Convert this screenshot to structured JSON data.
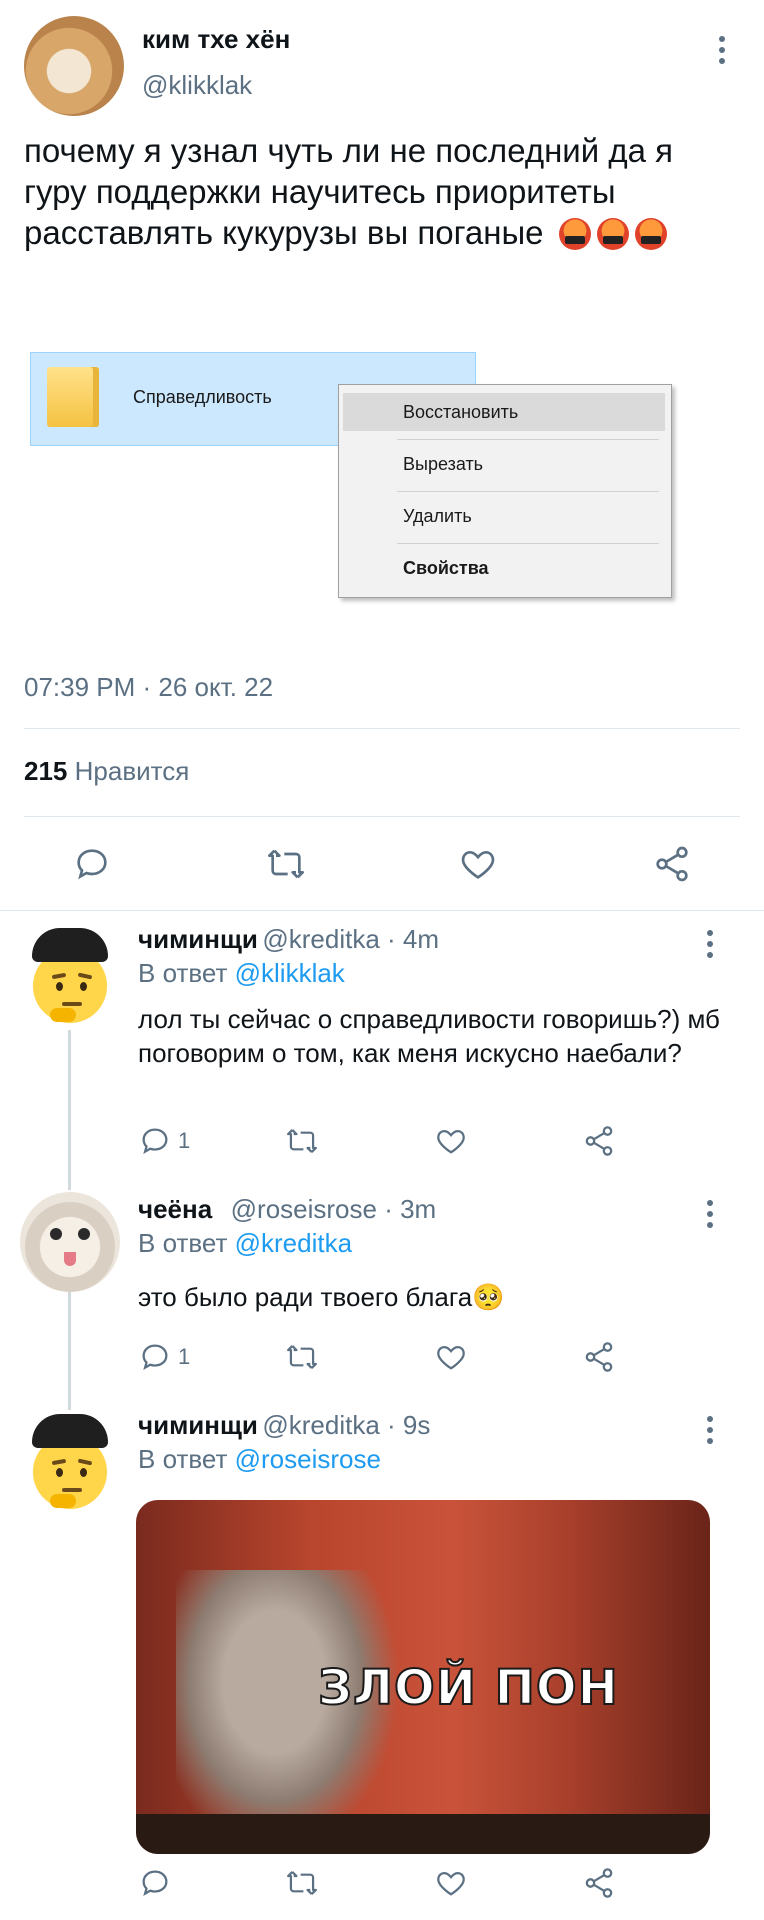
{
  "tweet": {
    "author_name": "ким тхе хён",
    "author_handle": "@klikklak",
    "text": "почему я узнал чуть ли не последний да я гуру поддержки научитесь приоритеты расставлять кукурузы вы поганые",
    "emoji_count": 3,
    "embedded_image": {
      "folder_name": "Справедливость",
      "context_menu": [
        "Восстановить",
        "Вырезать",
        "Удалить",
        "Свойства"
      ],
      "highlighted_item": "Восстановить",
      "bold_item": "Свойства"
    },
    "time": "07:39 PM · 26 окт. 22",
    "likes_count": "215",
    "likes_label": "Нравится"
  },
  "replies": [
    {
      "name": "чиминщи",
      "meta": "@kreditka · 4m",
      "reply_prefix": "В ответ",
      "reply_to": "@klikklak",
      "text": "лол ты сейчас о справедливости говоришь?) мб поговорим о том, как меня искусно наебали?",
      "reply_count": "1"
    },
    {
      "name": "чеёна",
      "meta": "@roseisrose · 3m",
      "reply_prefix": "В ответ",
      "reply_to": "@kreditka",
      "text": "это было ради твоего блага🥺",
      "reply_count": "1"
    },
    {
      "name": "чиминщи",
      "meta": "@kreditka · 9s",
      "reply_prefix": "В ответ",
      "reply_to": "@roseisrose",
      "gif_caption": "ЗЛОЙ ПОН"
    }
  ],
  "colors": {
    "link": "#1d9bf0",
    "muted": "#5b7083",
    "text": "#0f1419",
    "divider": "#e1e8ed"
  }
}
